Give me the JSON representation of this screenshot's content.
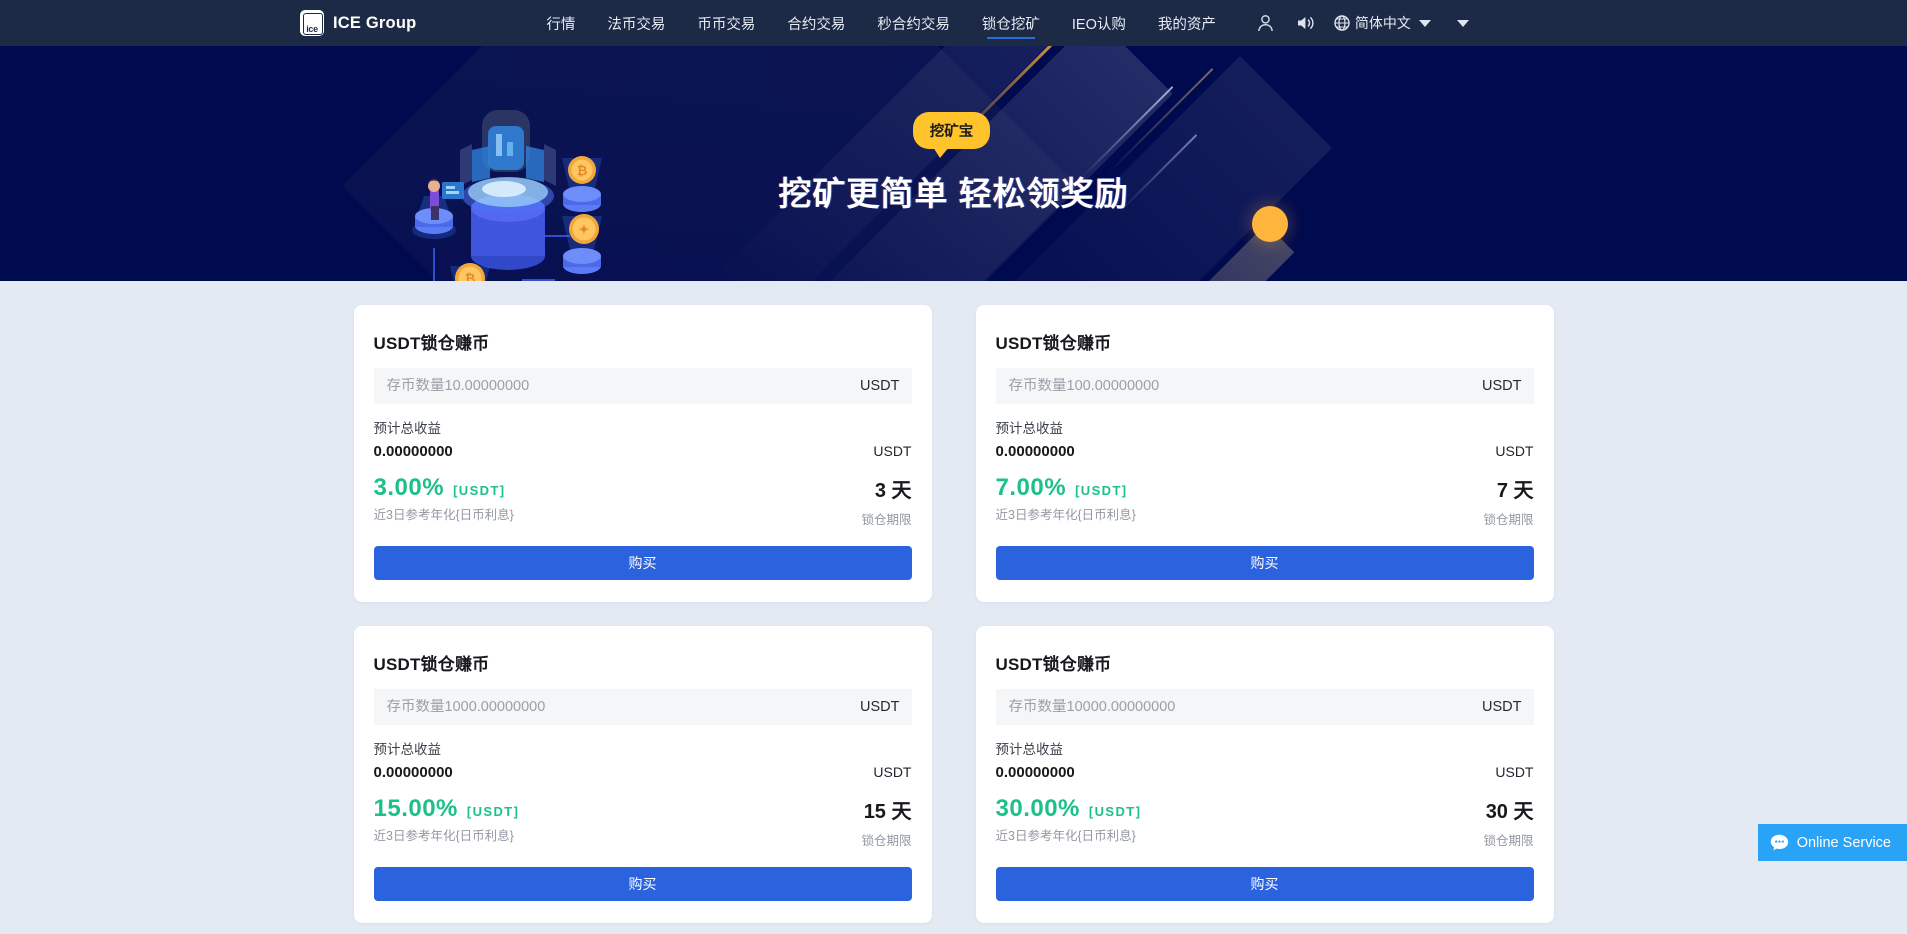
{
  "header": {
    "logo_text": "ICE Group",
    "logo_mark_text": "ice",
    "nav": [
      {
        "label": "行情",
        "active": false
      },
      {
        "label": "法币交易",
        "active": false
      },
      {
        "label": "币币交易",
        "active": false
      },
      {
        "label": "合约交易",
        "active": false
      },
      {
        "label": "秒合约交易",
        "active": false
      },
      {
        "label": "锁仓挖矿",
        "active": true
      },
      {
        "label": "IEO认购",
        "active": false
      },
      {
        "label": "我的资产",
        "active": false
      }
    ],
    "language": "简体中文",
    "accent_active": "#2f6bdd",
    "bg": "#1c2a46"
  },
  "banner": {
    "badge": "挖矿宝",
    "title": "挖矿更简单 轻松领奖励",
    "bg": "#000a4e",
    "badge_bg": "#ffc32b"
  },
  "cards": [
    {
      "title": "USDT锁仓赚币",
      "amount_placeholder": "存币数量10.00000000",
      "amount_value": "",
      "amount_unit": "USDT",
      "profit_label": "预计总收益",
      "profit_value": "0.00000000",
      "profit_unit": "USDT",
      "rate": "3.00%",
      "rate_coin": "[USDT]",
      "rate_sub": "近3日参考年化{日币利息}",
      "days": "3 天",
      "days_sub": "锁仓期限",
      "buy_label": "购买"
    },
    {
      "title": "USDT锁仓赚币",
      "amount_placeholder": "存币数量100.00000000",
      "amount_value": "",
      "amount_unit": "USDT",
      "profit_label": "预计总收益",
      "profit_value": "0.00000000",
      "profit_unit": "USDT",
      "rate": "7.00%",
      "rate_coin": "[USDT]",
      "rate_sub": "近3日参考年化{日币利息}",
      "days": "7 天",
      "days_sub": "锁仓期限",
      "buy_label": "购买"
    },
    {
      "title": "USDT锁仓赚币",
      "amount_placeholder": "存币数量1000.00000000",
      "amount_value": "",
      "amount_unit": "USDT",
      "profit_label": "预计总收益",
      "profit_value": "0.00000000",
      "profit_unit": "USDT",
      "rate": "15.00%",
      "rate_coin": "[USDT]",
      "rate_sub": "近3日参考年化{日币利息}",
      "days": "15 天",
      "days_sub": "锁仓期限",
      "buy_label": "购买"
    },
    {
      "title": "USDT锁仓赚币",
      "amount_placeholder": "存币数量10000.00000000",
      "amount_value": "",
      "amount_unit": "USDT",
      "profit_label": "预计总收益",
      "profit_value": "0.00000000",
      "profit_unit": "USDT",
      "rate": "30.00%",
      "rate_coin": "[USDT]",
      "rate_sub": "近3日参考年化{日币利息}",
      "days": "30 天",
      "days_sub": "锁仓期限",
      "buy_label": "购买"
    }
  ],
  "online_service": {
    "label": "Online Service",
    "bg": "#29a3f5"
  },
  "colors": {
    "page_bg": "#e4eaf3",
    "card_bg": "#ffffff",
    "rate_green": "#1dbf8a",
    "button_blue": "#2b62de"
  }
}
